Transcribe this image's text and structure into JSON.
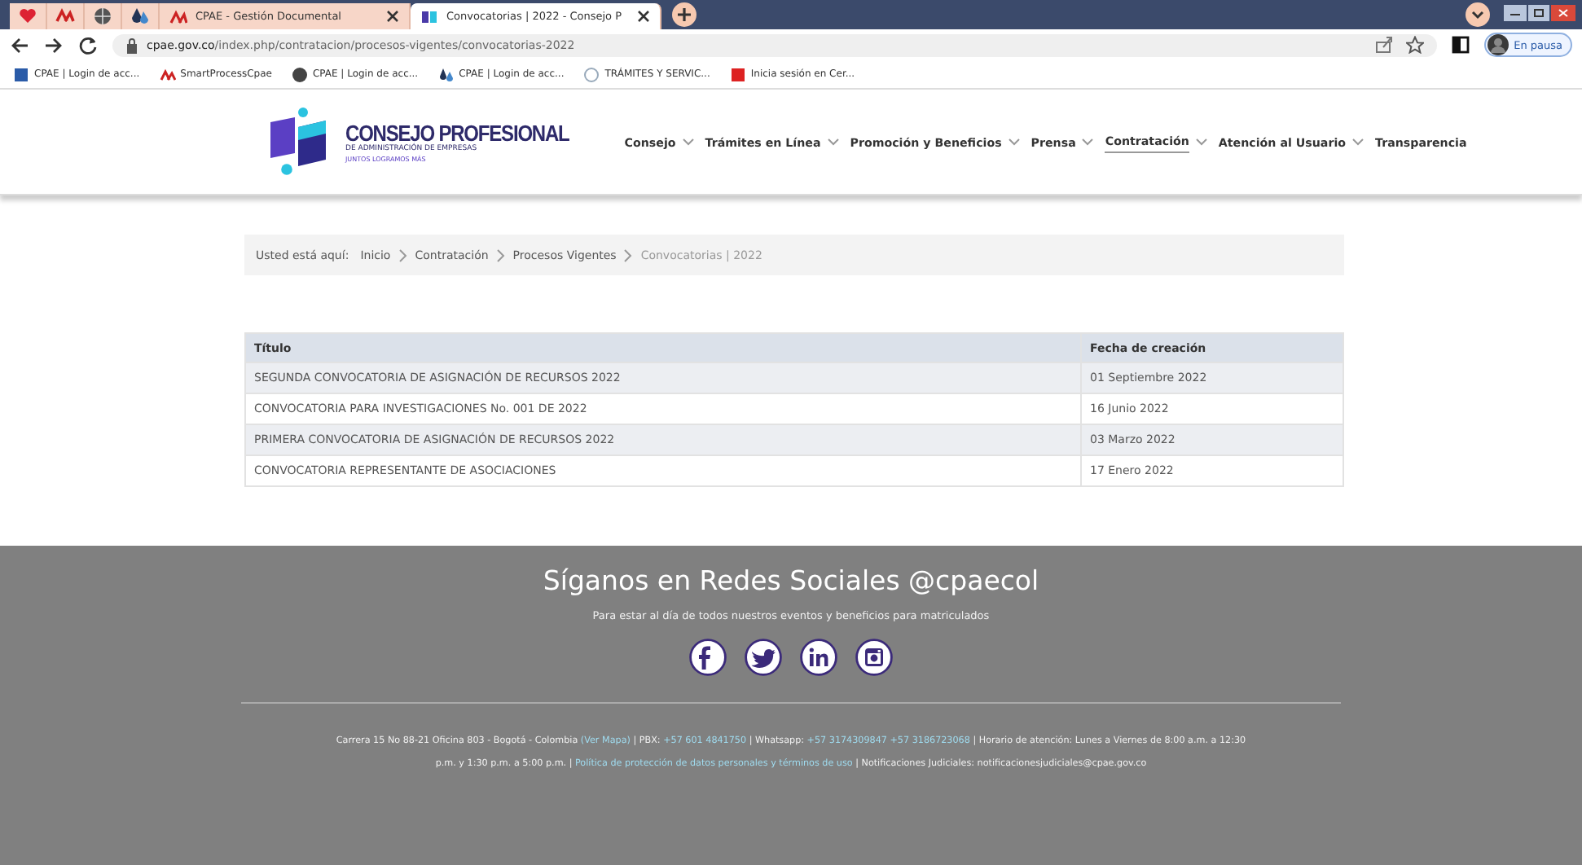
{
  "browser": {
    "tabs": [
      {
        "label": "CPAE - Gestión Documental",
        "selected": false
      },
      {
        "label": "Convocatorias | 2022 - Consejo P",
        "selected": true
      }
    ],
    "url_domain": "cpae.gov.co",
    "url_path": "/index.php/contratacion/procesos-vigentes/convocatorias-2022",
    "profile": "En pausa",
    "bookmarks": [
      "CPAE | Login de acc...",
      "SmartProcessCpae",
      "CPAE | Login de acc...",
      "CPAE | Login de acc...",
      "TRÁMITES Y SERVIC...",
      "Inicia sesión en Cer..."
    ]
  },
  "logo": {
    "title": "CONSEJO PROFESIONAL",
    "subtitle": "DE ADMINISTRACIÓN DE EMPRESAS",
    "tagline": "JUNTOS LOGRAMOS MÁS"
  },
  "nav": [
    {
      "label": "Consejo",
      "has_menu": true,
      "selected": false
    },
    {
      "label": "Trámites en Línea",
      "has_menu": true,
      "selected": false
    },
    {
      "label": "Promoción y Beneficios",
      "has_menu": true,
      "selected": false
    },
    {
      "label": "Prensa",
      "has_menu": true,
      "selected": false
    },
    {
      "label": "Contratación",
      "has_menu": true,
      "selected": true
    },
    {
      "label": "Atención al Usuario",
      "has_menu": true,
      "selected": false
    },
    {
      "label": "Transparencia",
      "has_menu": false,
      "selected": false
    }
  ],
  "breadcrumb": {
    "label": "Usted está aquí:",
    "items": [
      {
        "text": "Inicio",
        "current": false
      },
      {
        "text": "Contratación",
        "current": false
      },
      {
        "text": "Procesos Vigentes",
        "current": false
      },
      {
        "text": "Convocatorias | 2022",
        "current": true
      }
    ]
  },
  "table": {
    "columns": [
      "Título",
      "Fecha de creación"
    ],
    "rows": [
      [
        "SEGUNDA CONVOCATORIA DE ASIGNACIÓN DE RECURSOS 2022",
        "01 Septiembre 2022"
      ],
      [
        "CONVOCATORIA PARA INVESTIGACIONES No. 001 DE 2022",
        "16 Junio 2022"
      ],
      [
        "PRIMERA CONVOCATORIA DE ASIGNACIÓN DE RECURSOS 2022",
        "03 Marzo 2022"
      ],
      [
        "CONVOCATORIA REPRESENTANTE DE ASOCIACIONES",
        "17 Enero 2022"
      ]
    ]
  },
  "footer": {
    "title": "Síganos en Redes Sociales @cpaecol",
    "subtitle": "Para estar al día de todos nuestros eventos y beneficios para matriculados",
    "info": [
      {
        "text": "Carrera 15 No 88-21 Oficina 803 - Bogotá - Colombia ",
        "link": false
      },
      {
        "text": "(Ver Mapa)",
        "link": true
      },
      {
        "text": " | PBX: ",
        "link": false
      },
      {
        "text": "+57 601 4841750",
        "link": true
      },
      {
        "text": " | Whatsapp: ",
        "link": false
      },
      {
        "text": "+57 3174309847 +57 3186723068",
        "link": true
      },
      {
        "text": " | Horario de atención: Lunes a Viernes de 8:00 a.m. a 12:30 p.m. y 1:30 p.m. a 5:00 p.m. | ",
        "link": false
      },
      {
        "text": "Política de protección de datos personales y términos de uso",
        "link": true
      },
      {
        "text": " | Notificaciones Judiciales: notificacionesjudiciales@cpae.gov.co",
        "link": false
      }
    ]
  }
}
